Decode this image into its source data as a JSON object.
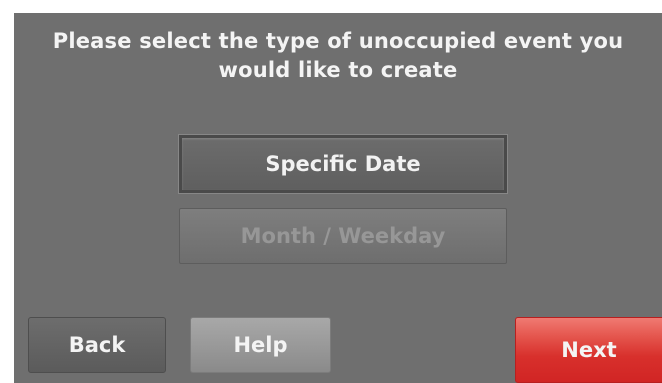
{
  "screen": {
    "prompt_line1": "Please select the type of unoccupied event you",
    "prompt_line2": "would like to create"
  },
  "options": {
    "specific_date": "Specific Date",
    "month_weekday": "Month / Weekday"
  },
  "footer": {
    "back_label": "Back",
    "help_label": "Help",
    "next_label": "Next"
  },
  "colors": {
    "background": "#6f6f6f",
    "next_button": "#d8302c",
    "help_button": "#989898"
  }
}
